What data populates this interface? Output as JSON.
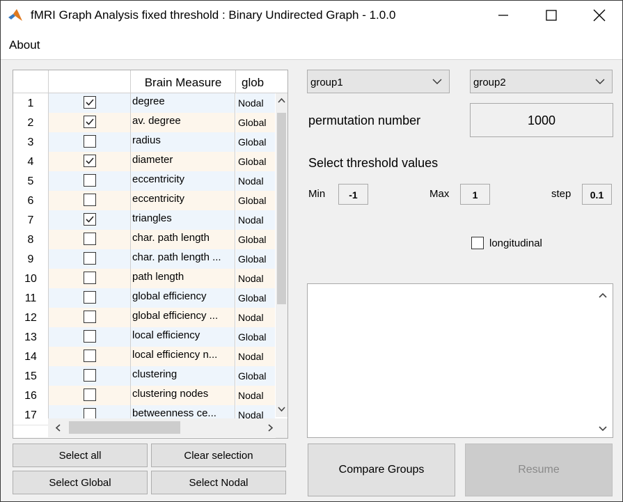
{
  "window": {
    "title": "fMRI Graph Analysis fixed threshold : Binary Undirected Graph  - 1.0.0",
    "app_icon": "matlab-icon",
    "controls": [
      "minimize-icon",
      "maximize-icon",
      "close-icon"
    ]
  },
  "menu": {
    "items": [
      "About"
    ]
  },
  "table": {
    "columns": [
      "",
      "",
      "Brain Measure",
      "glob"
    ],
    "rows": [
      {
        "num": "1",
        "checked": true,
        "measure": "degree",
        "type": "Nodal"
      },
      {
        "num": "2",
        "checked": true,
        "measure": "av. degree",
        "type": "Global"
      },
      {
        "num": "3",
        "checked": false,
        "measure": "radius",
        "type": "Global"
      },
      {
        "num": "4",
        "checked": true,
        "measure": "diameter",
        "type": "Global"
      },
      {
        "num": "5",
        "checked": false,
        "measure": "eccentricity",
        "type": "Nodal"
      },
      {
        "num": "6",
        "checked": false,
        "measure": "eccentricity",
        "type": "Global"
      },
      {
        "num": "7",
        "checked": true,
        "measure": "triangles",
        "type": "Nodal"
      },
      {
        "num": "8",
        "checked": false,
        "measure": "char. path length",
        "type": "Global"
      },
      {
        "num": "9",
        "checked": false,
        "measure": "char. path length ...",
        "type": "Global"
      },
      {
        "num": "10",
        "checked": false,
        "measure": "path length",
        "type": "Nodal"
      },
      {
        "num": "11",
        "checked": false,
        "measure": "global efficiency",
        "type": "Global"
      },
      {
        "num": "12",
        "checked": false,
        "measure": "global efficiency ...",
        "type": "Nodal"
      },
      {
        "num": "13",
        "checked": false,
        "measure": "local efficiency",
        "type": "Global"
      },
      {
        "num": "14",
        "checked": false,
        "measure": "local efficiency n...",
        "type": "Nodal"
      },
      {
        "num": "15",
        "checked": false,
        "measure": "clustering",
        "type": "Global"
      },
      {
        "num": "16",
        "checked": false,
        "measure": "clustering nodes",
        "type": "Nodal"
      },
      {
        "num": "17",
        "checked": false,
        "measure": "betweenness ce...",
        "type": "Nodal"
      }
    ],
    "colors": {
      "row_odd": "#eef5fc",
      "row_even": "#fdf6ec"
    }
  },
  "buttons": {
    "select_all": "Select all",
    "clear_selection": "Clear selection",
    "select_global": "Select Global",
    "select_nodal": "Select Nodal",
    "compare_groups": "Compare Groups",
    "resume": "Resume"
  },
  "groups": {
    "group1": "group1",
    "group2": "group2"
  },
  "permutation": {
    "label": "permutation number",
    "value": "1000"
  },
  "threshold": {
    "heading": "Select threshold values",
    "min_label": "Min",
    "min_value": "-1",
    "max_label": "Max",
    "max_value": "1",
    "step_label": "step",
    "step_value": "0.1"
  },
  "longitudinal": {
    "label": "longitudinal",
    "checked": false
  },
  "console": {
    "text": ""
  }
}
